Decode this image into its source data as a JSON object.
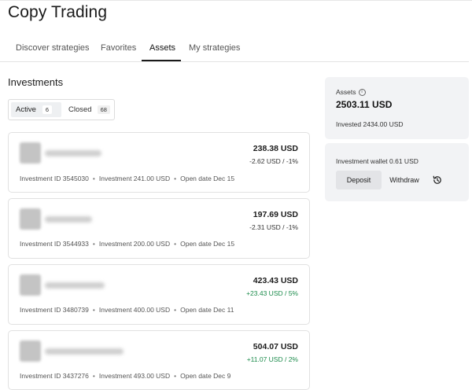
{
  "page": {
    "title": "Copy Trading"
  },
  "tabs": [
    {
      "label": "Discover strategies"
    },
    {
      "label": "Favorites"
    },
    {
      "label": "Assets"
    },
    {
      "label": "My strategies"
    }
  ],
  "investments": {
    "title": "Investments",
    "filters": [
      {
        "label": "Active",
        "count": "6"
      },
      {
        "label": "Closed",
        "count": "68"
      }
    ],
    "items": [
      {
        "amount": "238.38 USD",
        "change": "-2.62 USD / -1%",
        "trend": "negative",
        "id_text": "Investment ID 3545030",
        "investment_text": "Investment 241.00 USD",
        "date_text": "Open date Dec 15"
      },
      {
        "amount": "197.69 USD",
        "change": "-2.31 USD / -1%",
        "trend": "negative",
        "id_text": "Investment ID 3544933",
        "investment_text": "Investment 200.00 USD",
        "date_text": "Open date Dec 15"
      },
      {
        "amount": "423.43 USD",
        "change": "+23.43 USD / 5%",
        "trend": "positive",
        "id_text": "Investment ID 3480739",
        "investment_text": "Investment 400.00 USD",
        "date_text": "Open date Dec 11"
      },
      {
        "amount": "504.07 USD",
        "change": "+11.07 USD / 2%",
        "trend": "positive",
        "id_text": "Investment ID 3437276",
        "investment_text": "Investment 493.00 USD",
        "date_text": "Open date Dec 9"
      }
    ]
  },
  "summary": {
    "assets_label": "Assets",
    "assets_value": "2503.11 USD",
    "invested_text": "Invested 2434.00 USD"
  },
  "wallet": {
    "text": "Investment wallet 0.61 USD",
    "deposit_label": "Deposit",
    "withdraw_label": "Withdraw"
  },
  "icons": {
    "info": "info-icon",
    "history": "history-icon"
  },
  "colors": {
    "positive": "#1a8a4a",
    "negative": "#333333",
    "panel_bg": "#f2f3f5"
  }
}
